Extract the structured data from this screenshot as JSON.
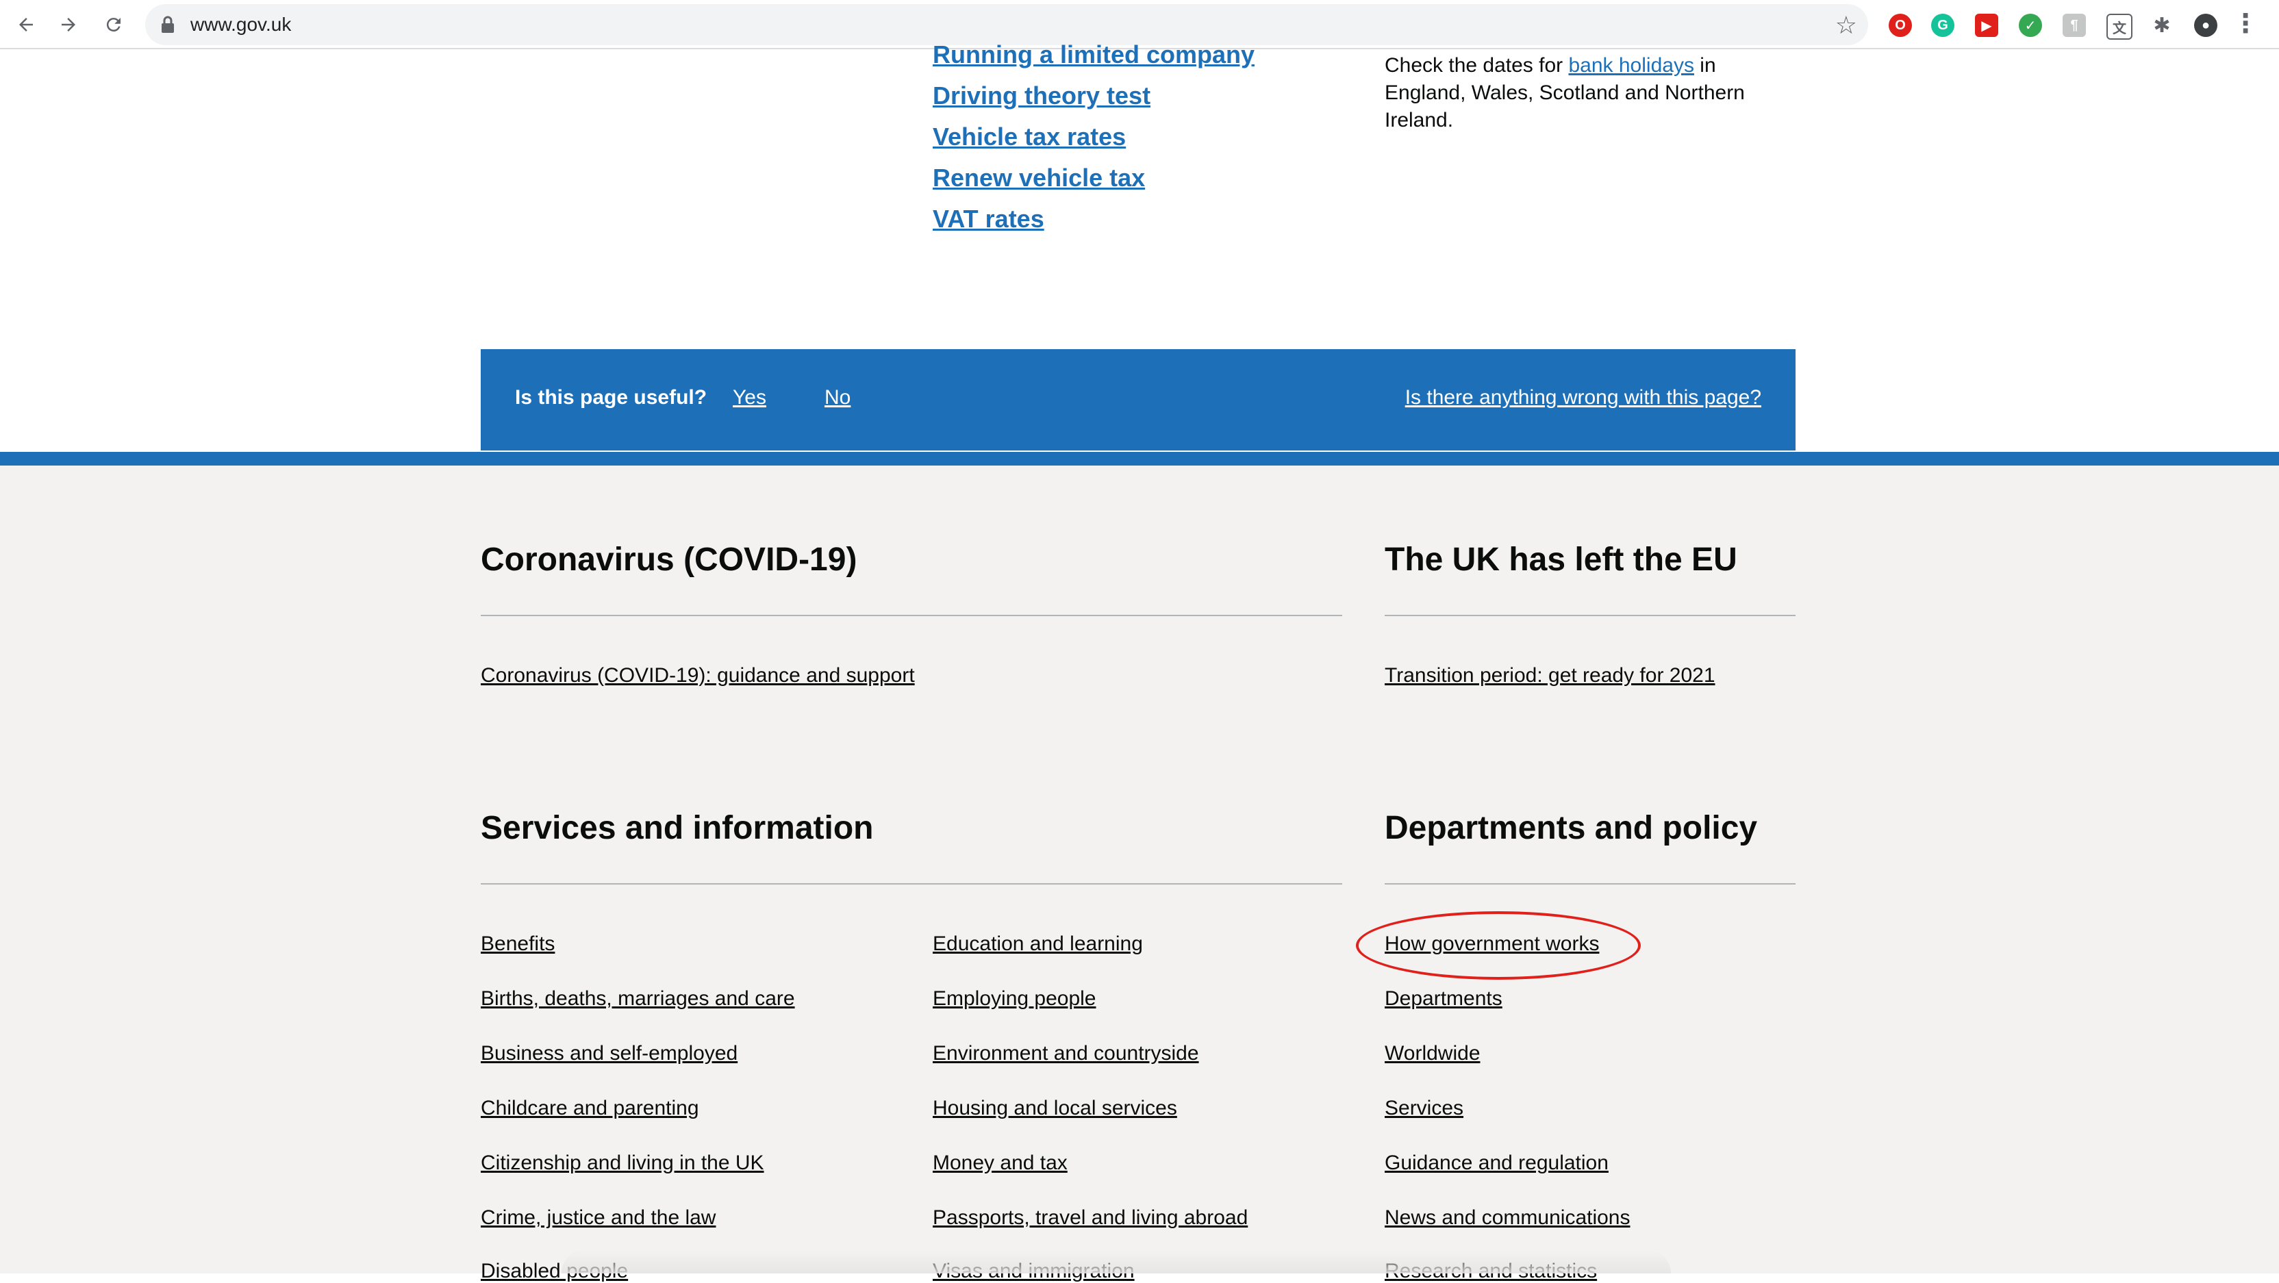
{
  "browser": {
    "url": "www.gov.uk",
    "colors": {
      "chrome_bg": "#ffffff",
      "omnibox_bg": "#f1f3f4"
    },
    "icons": [
      "back-arrow-icon",
      "forward-arrow-icon",
      "reload-icon",
      "lock-icon",
      "star-icon",
      "opera-icon",
      "grammarly-icon",
      "youtube-icon",
      "shield-icon",
      "extension-grey-icon",
      "translate-icon",
      "puzzle-icon",
      "profile-avatar",
      "menu-dots-icon"
    ]
  },
  "popular": {
    "links": [
      "Running a limited company",
      "Driving theory test",
      "Vehicle tax rates",
      "Renew vehicle tax",
      "VAT rates"
    ]
  },
  "holidays": {
    "pre": "Check the dates for ",
    "link": "bank holidays",
    "post": " in England, Wales, Scotland and Northern Ireland."
  },
  "feedback": {
    "question": "Is this page useful?",
    "yes": "Yes",
    "no": "No",
    "report": "Is there anything wrong with this page?",
    "color": "#1d70b8"
  },
  "footer": {
    "background": "#f3f2f1",
    "coronavirus": {
      "heading": "Coronavirus (COVID-19)",
      "link": "Coronavirus (COVID-19): guidance and support"
    },
    "brexit": {
      "heading": "The UK has left the EU",
      "link": "Transition period: get ready for 2021"
    },
    "services": {
      "heading": "Services and information",
      "col1": [
        "Benefits",
        "Births, deaths, marriages and care",
        "Business and self-employed",
        "Childcare and parenting",
        "Citizenship and living in the UK",
        "Crime, justice and the law",
        "Disabled people"
      ],
      "col2": [
        "Education and learning",
        "Employing people",
        "Environment and countryside",
        "Housing and local services",
        "Money and tax",
        "Passports, travel and living abroad",
        "Visas and immigration"
      ]
    },
    "departments": {
      "heading": "Departments and policy",
      "links": [
        "How government works",
        "Departments",
        "Worldwide",
        "Services",
        "Guidance and regulation",
        "News and communications",
        "Research and statistics"
      ]
    },
    "annotation_color": "#e0201b"
  }
}
